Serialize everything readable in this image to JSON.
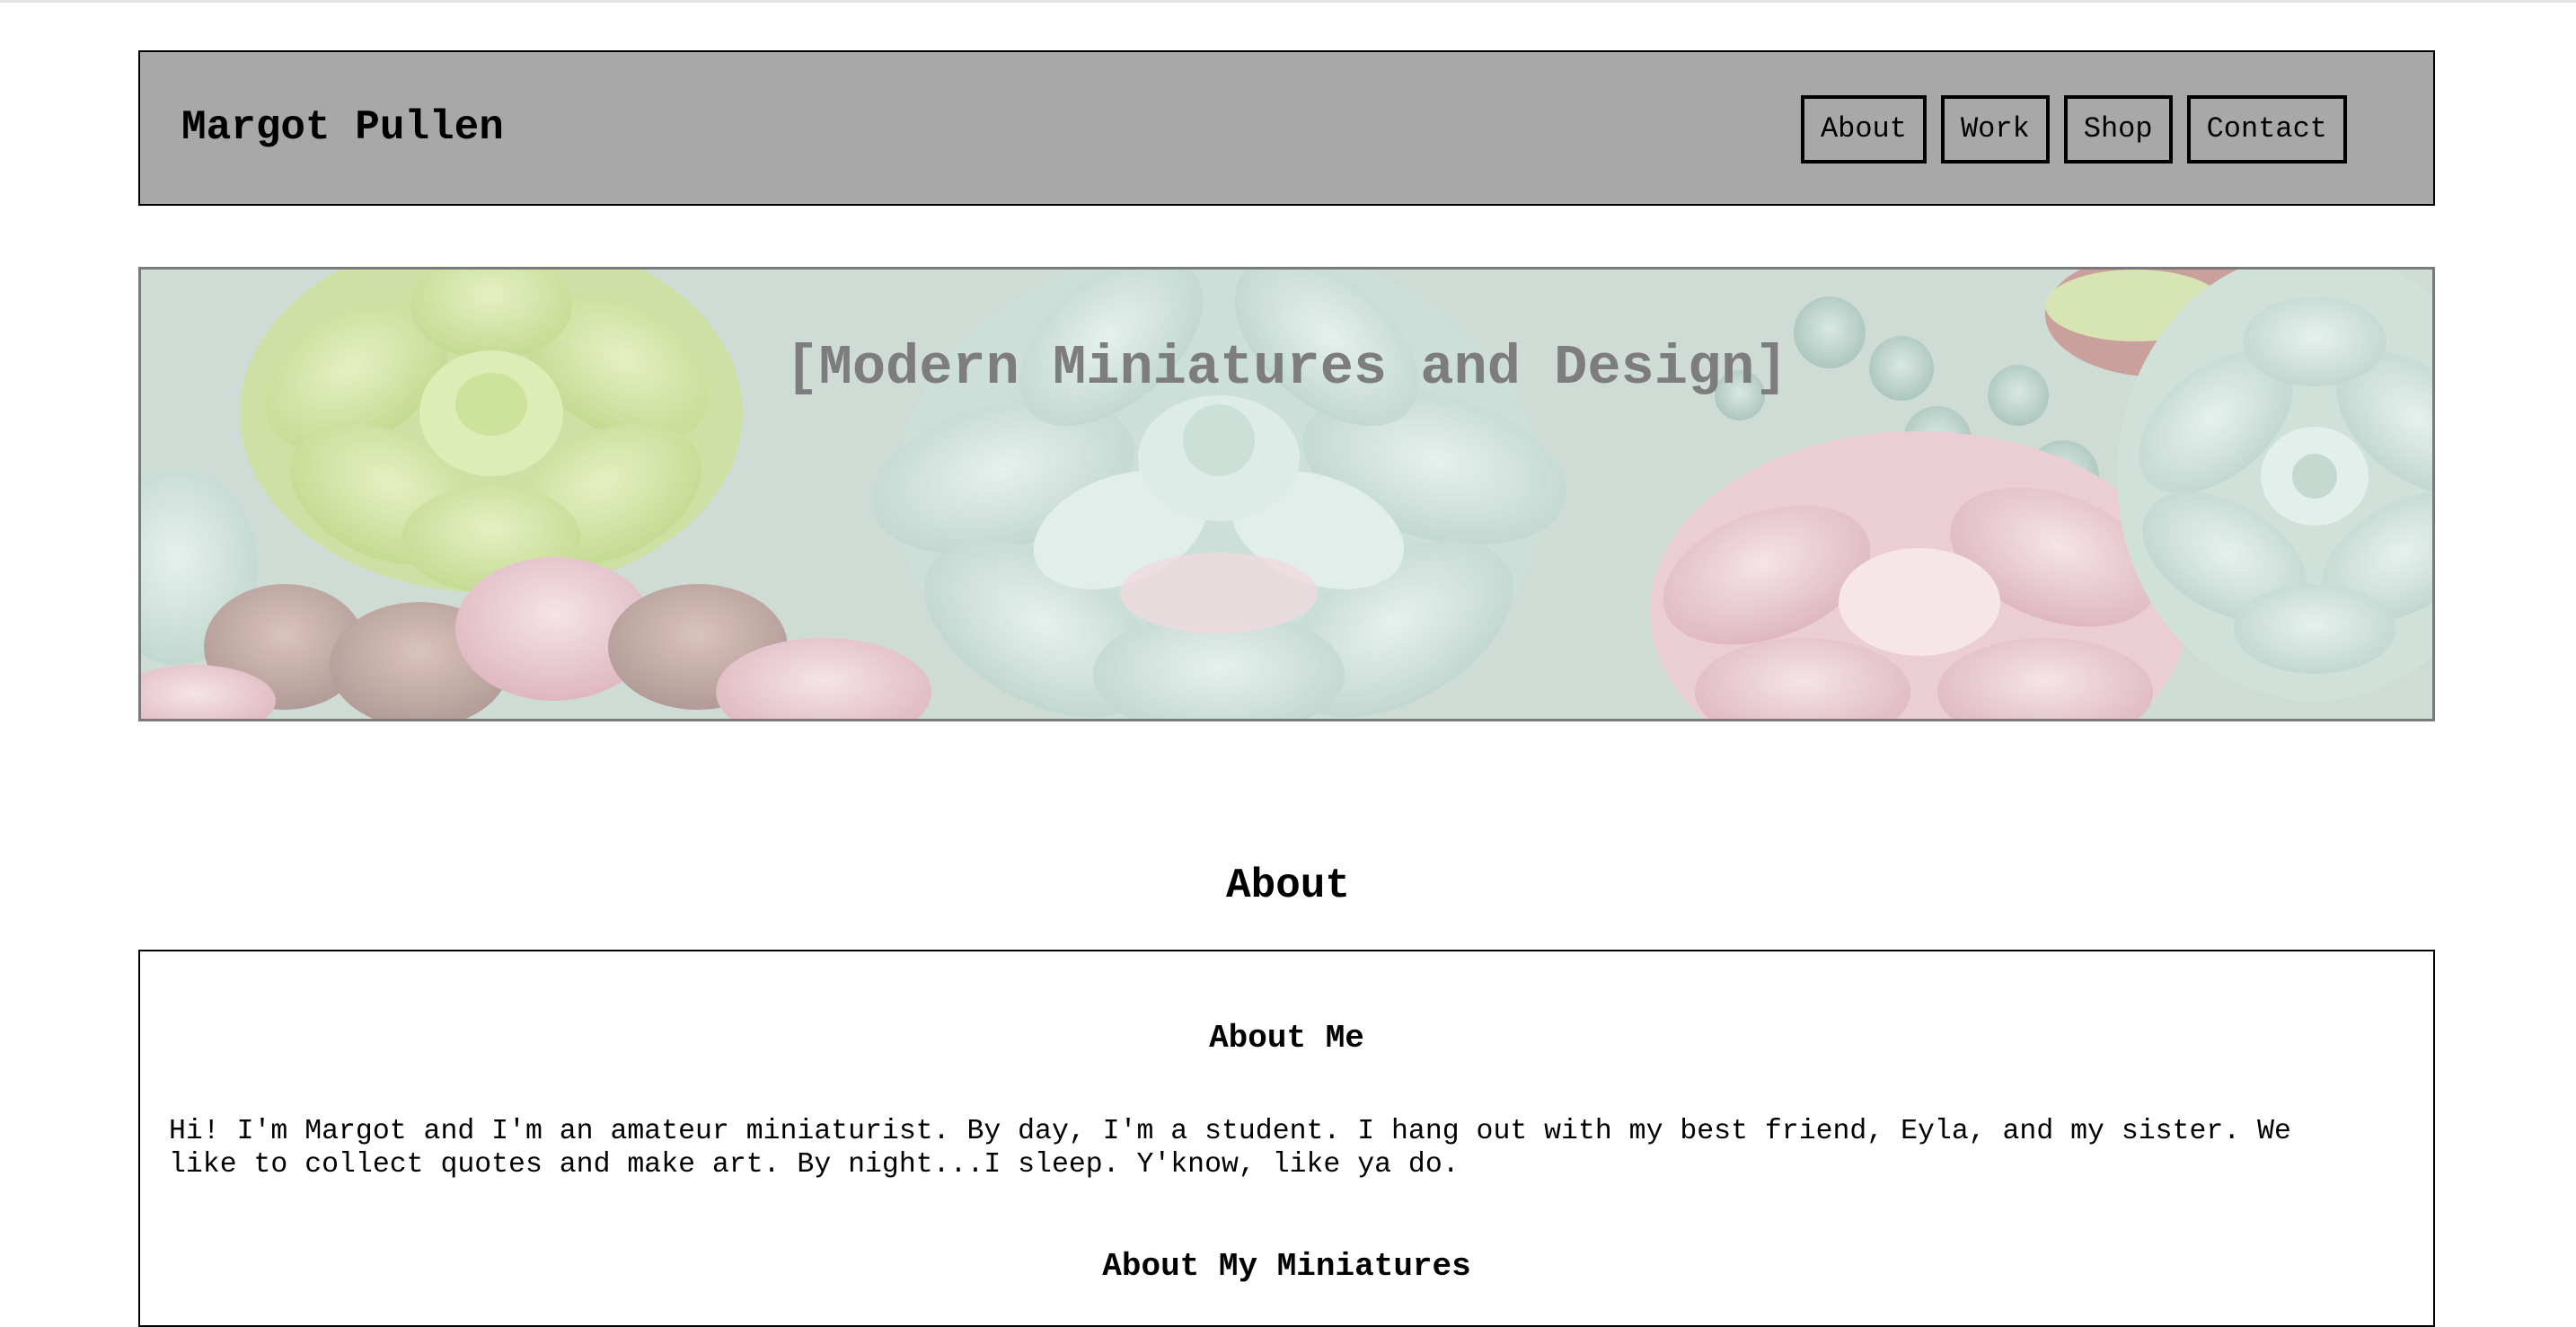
{
  "header": {
    "title": "Margot Pullen",
    "nav": [
      {
        "label": "About"
      },
      {
        "label": "Work"
      },
      {
        "label": "Shop"
      },
      {
        "label": "Contact"
      }
    ]
  },
  "banner": {
    "tagline": "[Modern Miniatures and Design]"
  },
  "main": {
    "section_title": "About",
    "about_me_heading": "About Me",
    "about_me_text": "Hi! I'm Margot and I'm an amateur miniaturist. By day, I'm a student. I hang out with my best friend, Eyla, and my sister. We like to collect quotes and make art. By night...I sleep. Y'know, like ya do.",
    "about_miniatures_heading": "About My Miniatures"
  }
}
